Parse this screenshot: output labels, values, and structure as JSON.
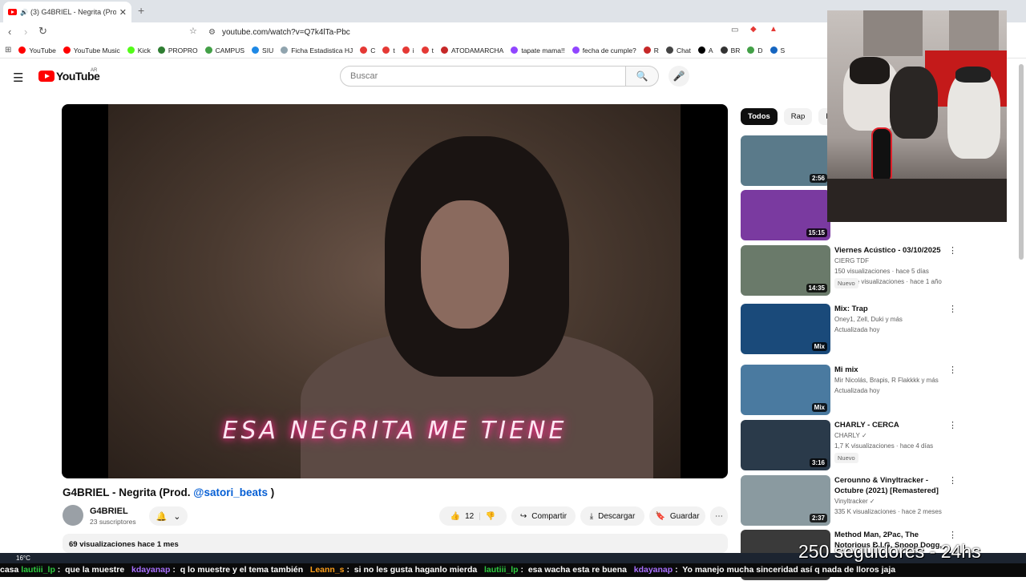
{
  "browser": {
    "tab_title": "(3) G4BRIEL - Negrita (Prod.",
    "url": "youtube.com/watch?v=Q7k4lTa-Pbc",
    "bookmarks": [
      {
        "label": "YouTube",
        "color": "#ff0000"
      },
      {
        "label": "YouTube Music",
        "color": "#ff0000"
      },
      {
        "label": "Kick",
        "color": "#53fc18"
      },
      {
        "label": "PROPRO",
        "color": "#2e7d32"
      },
      {
        "label": "CAMPUS",
        "color": "#43a047"
      },
      {
        "label": "SIU",
        "color": "#1e88e5"
      },
      {
        "label": "Ficha Estadistica HJ",
        "color": "#90a4ae"
      },
      {
        "label": "C",
        "color": "#e53935"
      },
      {
        "label": "t",
        "color": "#e53935"
      },
      {
        "label": "i",
        "color": "#e53935"
      },
      {
        "label": "t",
        "color": "#e53935"
      },
      {
        "label": "ATODAMARCHA",
        "color": "#c62828"
      },
      {
        "label": "tapate mama!!",
        "color": "#9146ff"
      },
      {
        "label": "fecha de cumple?",
        "color": "#9146ff"
      },
      {
        "label": "R",
        "color": "#c62828"
      },
      {
        "label": "Chat",
        "color": "#444444"
      },
      {
        "label": "A",
        "color": "#000000"
      },
      {
        "label": "BR",
        "color": "#333333"
      },
      {
        "label": "D",
        "color": "#43a047"
      },
      {
        "label": "S",
        "color": "#1565c0"
      }
    ]
  },
  "youtube": {
    "logo": "YouTube",
    "country": "AR",
    "search_placeholder": "Buscar"
  },
  "video": {
    "caption": "ESA NEGRITA ME TIENE",
    "title_prefix": "G4BRIEL - Negrita (Prod. ",
    "title_link": "@satori_beats",
    "title_suffix": " )",
    "channel": "G4BRIEL",
    "subscribers": "23 suscriptores",
    "likes": "12",
    "share": "Compartir",
    "download": "Descargar",
    "save": "Guardar",
    "views_date": "69 visualizaciones  hace 1 mes"
  },
  "chips": [
    "Todos",
    "Rap",
    "Rela"
  ],
  "recs": [
    {
      "title": "",
      "meta1": "",
      "meta2": "",
      "duration": "2:56",
      "thumb": "#5a7a8a"
    },
    {
      "title": "",
      "meta1": "",
      "meta2": "9,2 M de visualizaciones · hace 1 año",
      "duration": "15:15",
      "thumb": "#7a3aa0"
    },
    {
      "title": "Viernes Acústico - 03/10/2025",
      "meta1": "CIERG TDF",
      "meta2": "150 visualizaciones · hace 5 días",
      "badge": "Nuevo",
      "duration": "14:35",
      "thumb": "#6a7a6a"
    },
    {
      "title": "Mix: Trap",
      "meta1": "Oney1, Zell, Duki y más",
      "meta2": "Actualizada hoy",
      "duration": "Mix",
      "thumb": "#1a4a7a"
    },
    {
      "title": "Mi mix",
      "meta1": "Mir Nicolás, Brapis, R Flakkkk y más",
      "meta2": "Actualizada hoy",
      "duration": "Mix",
      "thumb": "#4a7aa0"
    },
    {
      "title": "CHARLY - CERCA",
      "meta1": "CHARLY ✓",
      "meta2": "1,7 K visualizaciones · hace 4 días",
      "badge": "Nuevo",
      "duration": "3:16",
      "thumb": "#2a3a4a"
    },
    {
      "title": "Cerounno & Vinyltracker - Octubre (2021) [Remastered]",
      "meta1": "Vinyltracker ✓",
      "meta2": "335 K visualizaciones · hace 2 meses",
      "duration": "2:37",
      "thumb": "#8a9aa0"
    },
    {
      "title": "Method Man, 2Pac, The Notorious B.I.G, Snoop Dogg,",
      "meta1": "",
      "meta2": "",
      "duration": "",
      "thumb": "#3a3a3a"
    }
  ],
  "overlay": {
    "followers": "250 seguidores - 24hs",
    "weather": "16°C",
    "chat": [
      {
        "user": "",
        "msg": "casa "
      },
      {
        "user": "lautiii_lp",
        "msg": " :  que la muestre   "
      },
      {
        "user": "kdayanap",
        "msg": " :  q lo muestre y el tema también   "
      },
      {
        "user": "Leann_s",
        "msg": " :  si no les gusta haganlo mierda   "
      },
      {
        "user": "lautiii_lp",
        "msg": " :  esa wacha esta re buena   "
      },
      {
        "user": "kdayanap",
        "msg": " :  Yo manejo mucha sinceridad así q nada de lloros jaja"
      }
    ]
  }
}
